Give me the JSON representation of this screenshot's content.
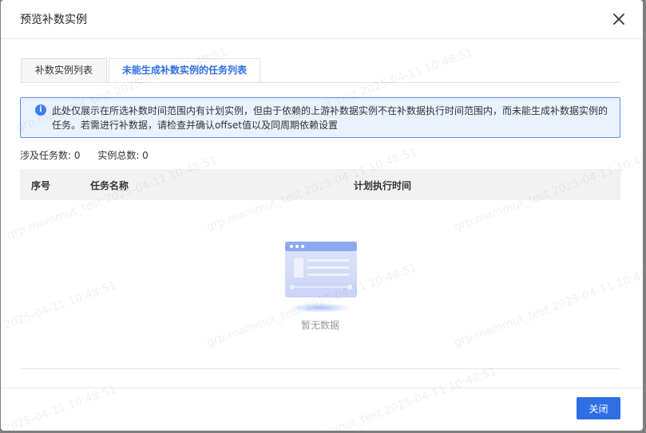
{
  "modal": {
    "title": "预览补数实例",
    "close_label": "关闭"
  },
  "tabs": [
    {
      "label": "补数实例列表"
    },
    {
      "label": "未能生成补数实例的任务列表"
    }
  ],
  "notice": {
    "text": "此处仅展示在所选补数时间范围内有计划实例，但由于依赖的上游补数据实例不在补数据执行时间范围内，而未能生成补数据实例的任务。若需进行补数据，请检查并确认offset值以及同周期依赖设置"
  },
  "stats": {
    "task_count": "涉及任务数: 0",
    "instance_count": "实例总数: 0"
  },
  "table": {
    "headers": [
      "序号",
      "任务名称",
      "计划执行时间"
    ],
    "empty_text": "暂无数据"
  },
  "watermark": {
    "text1": "grp.mammut_test 2025-04-11 10:48:51",
    "text2": "2025-04-11 10:48:51"
  },
  "colors": {
    "accent": "#2f6fe4",
    "notice_bg": "#eaf2fe",
    "notice_border": "#5b8ff2"
  }
}
